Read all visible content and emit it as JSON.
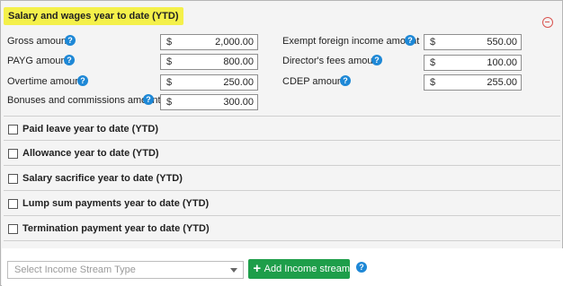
{
  "section": {
    "title": "Salary and wages year to date (YTD)"
  },
  "fields_left": [
    {
      "label": "Gross amount",
      "currency": "$",
      "value": "2,000.00"
    },
    {
      "label": "PAYG amount",
      "currency": "$",
      "value": "800.00"
    },
    {
      "label": "Overtime amount",
      "currency": "$",
      "value": "250.00"
    },
    {
      "label": "Bonuses and commissions amount",
      "currency": "$",
      "value": "300.00"
    }
  ],
  "fields_right": [
    {
      "label": "Exempt foreign income amount",
      "currency": "$",
      "value": "550.00"
    },
    {
      "label": "Director's fees amount",
      "currency": "$",
      "value": "100.00"
    },
    {
      "label": "CDEP amount",
      "currency": "$",
      "value": "255.00"
    }
  ],
  "checkbox_sections": [
    {
      "label": "Paid leave year to date (YTD)"
    },
    {
      "label": "Allowance year to date (YTD)"
    },
    {
      "label": "Salary sacrifice year to date (YTD)"
    },
    {
      "label": "Lump sum payments year to date (YTD)"
    },
    {
      "label": "Termination payment year to date (YTD)"
    }
  ],
  "footer": {
    "select_placeholder": "Select Income Stream Type",
    "add_button_label": "Add Income stream"
  },
  "icons": {
    "help": "help-icon",
    "remove": "remove-circle-icon",
    "plus": "plus-icon",
    "caret": "chevron-down-icon"
  },
  "colors": {
    "title_highlight": "#f4f04a",
    "help_icon": "#1e88d6",
    "remove_icon": "#d9534f",
    "add_button": "#1e9e4a"
  }
}
